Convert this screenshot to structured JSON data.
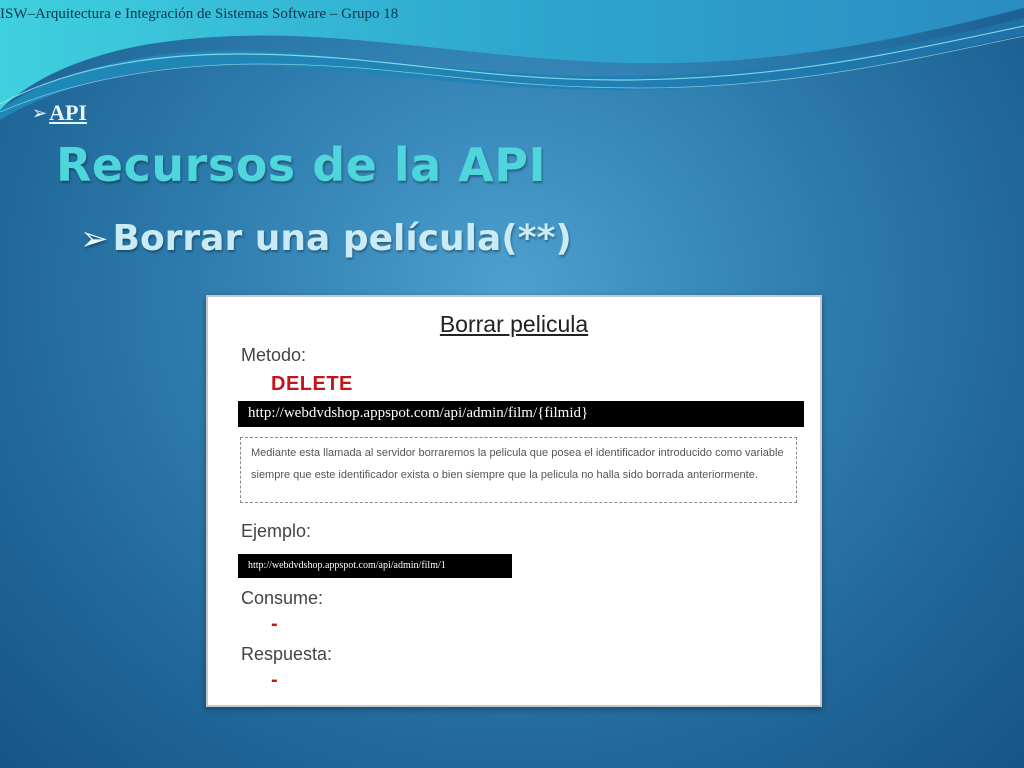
{
  "header": {
    "text": "ISW–Arquitectura e Integración de Sistemas Software – Grupo 18"
  },
  "breadcrumb": {
    "arrow": "➢",
    "label": "API"
  },
  "slide": {
    "title": "Recursos de la API",
    "subtitle_arrow": "➢",
    "subtitle": "Borrar una película(**)"
  },
  "panel": {
    "heading": "Borrar pelicula",
    "method_label": "Metodo:",
    "method_value": "DELETE",
    "url": "http://webdvdshop.appspot.com/api/admin/film/{filmid}",
    "description": "Mediante esta llamada al servidor borraremos la pelicula que posea el identificador introducido como variable siempre que este identificador exista o bien siempre que la pelicula no halla sido borrada anteriormente.",
    "example_label": "Ejemplo:",
    "example_url": "http://webdvdshop.appspot.com/api/admin/film/1",
    "consume_label": "Consume:",
    "consume_value": "-",
    "response_label": "Respuesta:",
    "response_value": "-"
  },
  "colors": {
    "title": "#4fd6dc",
    "method": "#c3141b",
    "background": "#2f7fb0"
  }
}
